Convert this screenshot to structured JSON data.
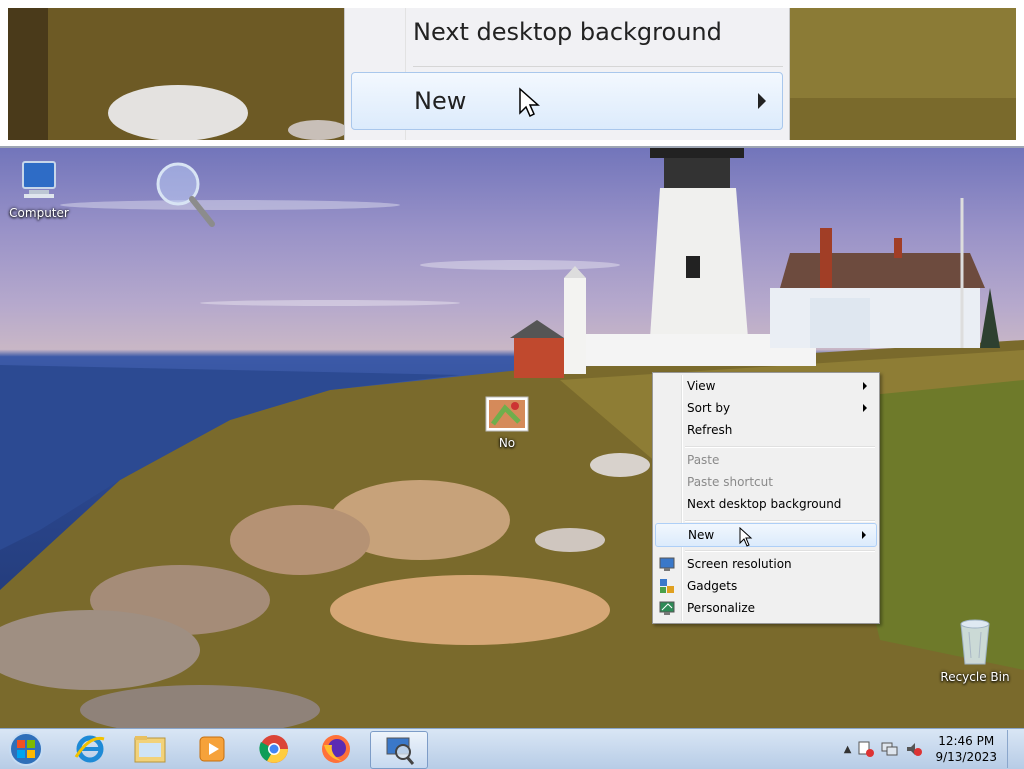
{
  "magnifier": {
    "menu_item_top": "Next desktop background",
    "menu_item_hover": "New"
  },
  "desktop": {
    "icons": {
      "computer": "Computer",
      "file": "No",
      "recycle_bin": "Recycle Bin"
    }
  },
  "context_menu": {
    "view": "View",
    "sort_by": "Sort by",
    "refresh": "Refresh",
    "paste": "Paste",
    "paste_shortcut": "Paste shortcut",
    "next_background": "Next desktop background",
    "new": "New",
    "screen_resolution": "Screen resolution",
    "gadgets": "Gadgets",
    "personalize": "Personalize"
  },
  "taskbar": {
    "apps": [
      "start-orb",
      "internet-explorer-icon",
      "file-explorer-icon",
      "media-player-icon",
      "chrome-icon",
      "firefox-icon",
      "magnifier-icon"
    ],
    "clock_time": "12:46 PM",
    "clock_date": "9/13/2023"
  }
}
